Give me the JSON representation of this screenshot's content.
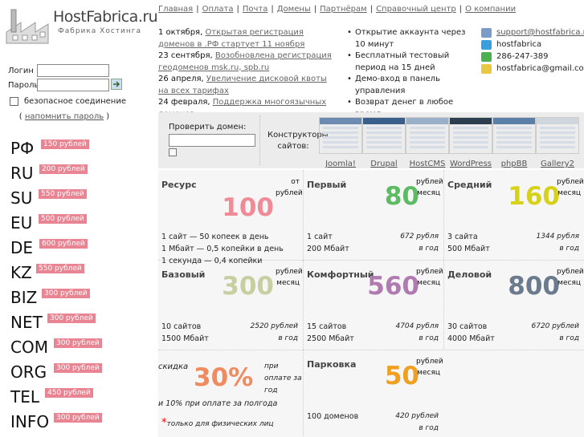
{
  "logo": {
    "name": "HostFabrica.ru",
    "tagline": "Фабрика Хостинга"
  },
  "login": {
    "login_label": "Логин",
    "password_label": "Пароль",
    "secure_label": "безопасное соединение",
    "remind_prefix": "(",
    "remind_link": "напомнить пароль",
    "remind_suffix": ")"
  },
  "domains": [
    {
      "zone": "РФ",
      "price": "150 рублей"
    },
    {
      "zone": "RU",
      "price": "200 рублей"
    },
    {
      "zone": "SU",
      "price": "550 рублей"
    },
    {
      "zone": "EU",
      "price": "500 рублей"
    },
    {
      "zone": "DE",
      "price": "600 рублей"
    },
    {
      "zone": "KZ",
      "price": "550 рублей"
    },
    {
      "zone": "BIZ",
      "price": "300 рублей"
    },
    {
      "zone": "NET",
      "price": "300 рублей"
    },
    {
      "zone": "COM",
      "price": "300 рублей"
    },
    {
      "zone": "ORG",
      "price": "300 рублей"
    },
    {
      "zone": "TEL",
      "price": "450 рублей"
    },
    {
      "zone": "INFO",
      "price": "300 рублей"
    }
  ],
  "nav": [
    "Главная",
    "Оплата",
    "Почта",
    "Домены",
    "Партнёрам",
    "Справочный центр",
    "О компании"
  ],
  "news": [
    {
      "date": "1 октября,",
      "text": "Открытая регистрация доменов в .РФ стартует 11 ноября"
    },
    {
      "date": "23 сентября,",
      "text": "Возобновлена регистрация геодоменов msk.ru, spb.ru"
    },
    {
      "date": "26 апреля,",
      "text": "Увеличение дисковой квоты на всех тарифах"
    },
    {
      "date": "24 февраля,",
      "text": "Поддержка многоязычных доменов"
    }
  ],
  "features": [
    "Открытие аккаунта через 10 минут",
    "Бесплатный тестовый период на 15 дней",
    "Демо-вход в панель управления",
    "Возврат денег в любое время"
  ],
  "contacts": [
    {
      "icon": "mail-icon",
      "text": "support@hostfabrica.ru",
      "color": "#7a9cc6"
    },
    {
      "icon": "skype-icon",
      "text": "hostfabrica",
      "color": "#3aa0dd"
    },
    {
      "icon": "icq-flower-icon",
      "text": "286-247-389",
      "color": "#4caf50"
    },
    {
      "icon": "lightbulb-icon",
      "text": "hostfabrica@gmail.com",
      "color": "#e8c840"
    }
  ],
  "check": {
    "label": "Проверить домен:",
    "placeholder": ""
  },
  "constructors": {
    "label": "Конструкторы сайтов:",
    "items": [
      "Joomla!",
      "Drupal",
      "HostCMS",
      "WordPress",
      "phpBB",
      "Gallery2"
    ]
  },
  "tariffs": [
    {
      "name": "Ресурс",
      "value": "100",
      "unit": "от рублей",
      "color": "#ef8b97",
      "features": [
        "1 сайт  —  50 копеек в день",
        "1 Мбайт  —  0,5 копейки в день",
        "1 секунда  —  0,4 копейки"
      ],
      "prices": []
    },
    {
      "name": "Первый",
      "value": "80",
      "unit": "рублей месяц",
      "color": "#5dbb63",
      "features": [
        "1 сайт",
        "200 Мбайт"
      ],
      "prices": [
        "672 рубля",
        "в год"
      ]
    },
    {
      "name": "Средний",
      "value": "160",
      "unit": "рублей месяц",
      "color": "#d6d21c",
      "features": [
        "3 сайта",
        "500 Мбайт"
      ],
      "prices": [
        "1344 рубля",
        "в год"
      ]
    },
    {
      "name": "Базовый",
      "value": "300",
      "unit": "рублей месяц",
      "color": "#c6cfa0",
      "features": [
        "10 сайтов",
        "1500 Мбайт"
      ],
      "prices": [
        "2520 рублей",
        "в год"
      ]
    },
    {
      "name": "Комфортный",
      "value": "560",
      "unit": "рублей месяц",
      "color": "#b07bb0",
      "features": [
        "15 сайтов",
        "2500 Мбайт"
      ],
      "prices": [
        "4704 рубля",
        "в год"
      ]
    },
    {
      "name": "Деловой",
      "value": "800",
      "unit": "рублей месяц",
      "color": "#6b7a8c",
      "features": [
        "30 сайтов",
        "4000 Мбайт"
      ],
      "prices": [
        "6720 рублей",
        "в год"
      ]
    },
    {
      "name": "Парковка",
      "value": "50",
      "unit": "рублей месяц",
      "color": "#f0a020",
      "features": [
        "100 доменов"
      ],
      "prices": [
        "420 рублей",
        "в год"
      ]
    }
  ],
  "discount": {
    "prefix": "скидка",
    "value": "30%",
    "note1": "при оплате за год",
    "note2": "и 10% при оплате за полгода",
    "footnote": "только для физических лиц",
    "color": "#ef8b60"
  }
}
